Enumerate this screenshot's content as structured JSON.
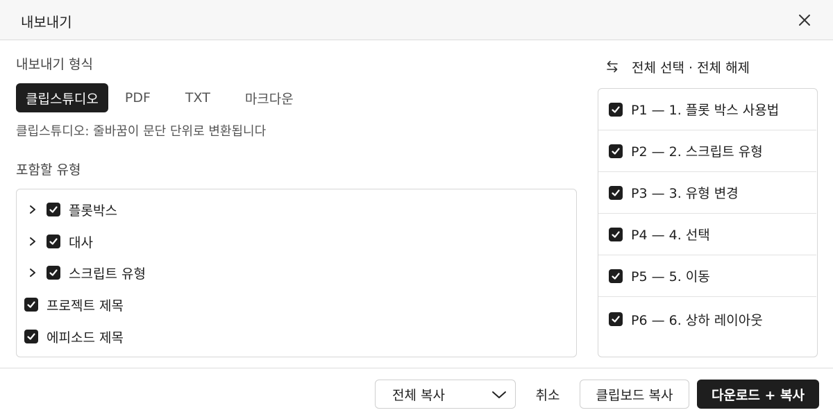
{
  "dialog": {
    "title": "내보내기"
  },
  "format": {
    "label": "내보내기 형식",
    "tabs": [
      {
        "label": "클립스튜디오",
        "active": true
      },
      {
        "label": "PDF",
        "active": false
      },
      {
        "label": "TXT",
        "active": false
      },
      {
        "label": "마크다운",
        "active": false
      }
    ],
    "description": "클립스튜디오: 줄바꿈이 문단 단위로 변환됩니다"
  },
  "types": {
    "label": "포함할 유형",
    "items": [
      {
        "label": "플롯박스",
        "checked": true,
        "expandable": true
      },
      {
        "label": "대사",
        "checked": true,
        "expandable": true
      },
      {
        "label": "스크립트 유형",
        "checked": true,
        "expandable": true
      },
      {
        "label": "프로젝트 제목",
        "checked": true,
        "expandable": false
      },
      {
        "label": "에피소드 제목",
        "checked": true,
        "expandable": false
      }
    ]
  },
  "pages": {
    "toggle_label": "전체 선택 · 전체 해제",
    "items": [
      {
        "label": "P1 — 1. 플롯 박스 사용법",
        "checked": true
      },
      {
        "label": "P2 — 2. 스크립트 유형",
        "checked": true
      },
      {
        "label": "P3 — 3. 유형 변경",
        "checked": true
      },
      {
        "label": "P4 — 4. 선택",
        "checked": true
      },
      {
        "label": "P5 — 5. 이동",
        "checked": true
      },
      {
        "label": "P6 — 6. 상하 레이아웃",
        "checked": true
      }
    ]
  },
  "footer": {
    "copy_mode": "전체 복사",
    "cancel_label": "취소",
    "clipboard_label": "클립보드 복사",
    "download_label": "다운로드 + 복사"
  },
  "colors": {
    "accent": "#1e1e1e",
    "border": "#d6d6d6",
    "header_bg": "#f7f7f7"
  }
}
